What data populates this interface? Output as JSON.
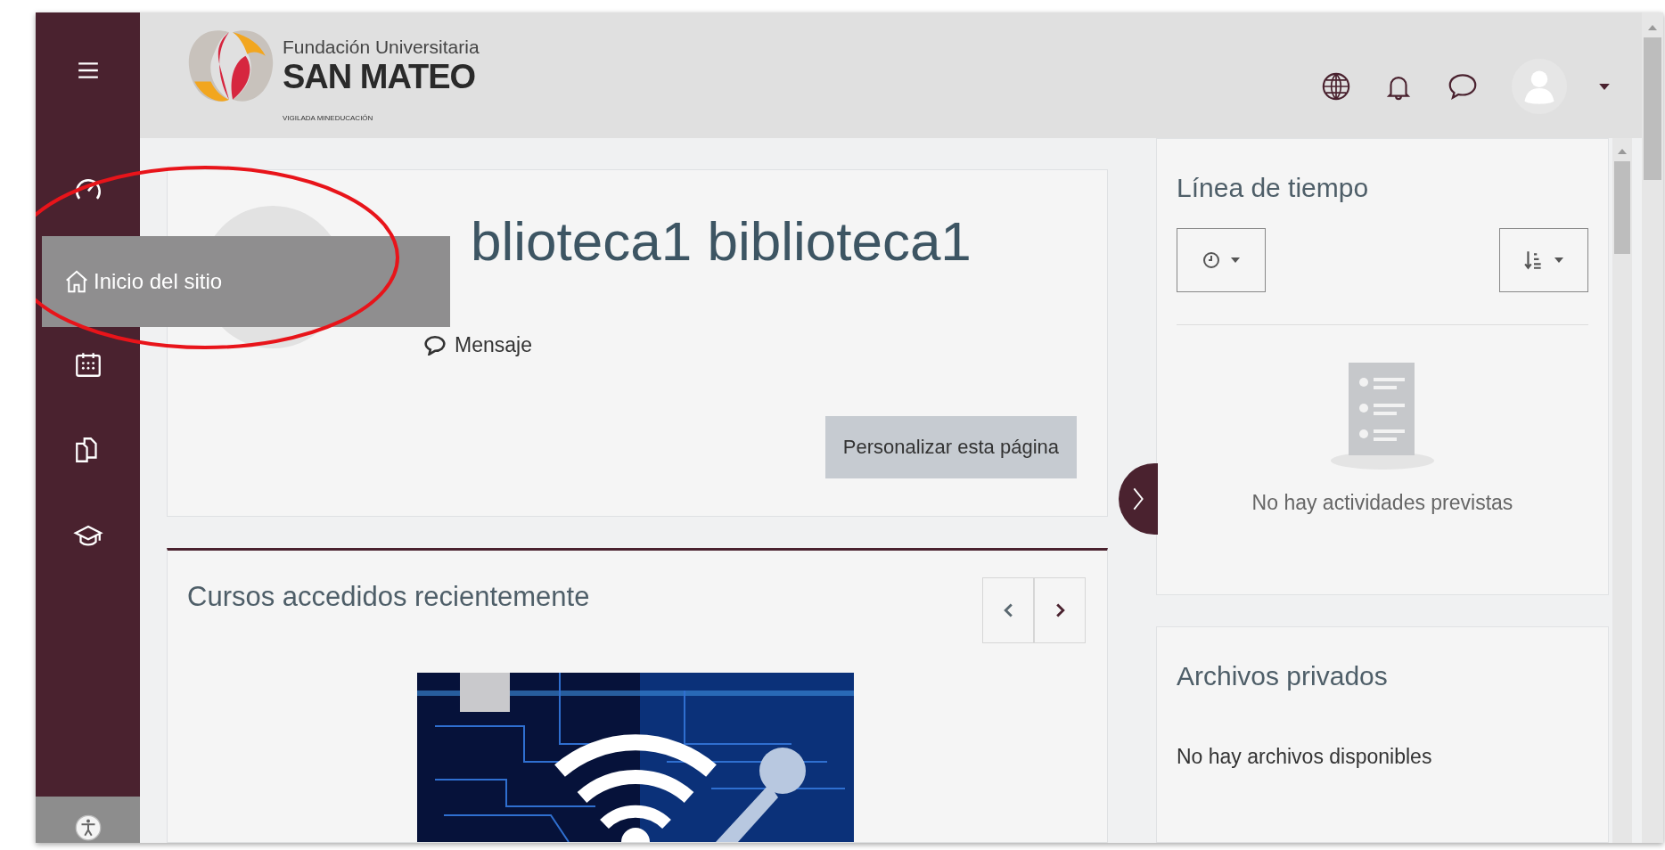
{
  "header": {
    "logo": {
      "line1": "Fundación Universitaria",
      "line2": "SAN MATEO",
      "tagline": "VIGILADA MINEDUCACIÓN"
    }
  },
  "tooltip": {
    "label": "Inicio del sitio"
  },
  "profile": {
    "name": "blioteca1 biblioteca1",
    "message_link": "Mensaje",
    "button": "Personalizar esta página"
  },
  "recent_courses": {
    "title": "Cursos accedidos recientemente"
  },
  "timeline": {
    "title": "Línea de tiempo",
    "empty": "No hay actividades previstas"
  },
  "private_files": {
    "title": "Archivos privados",
    "empty": "No hay archivos disponibles"
  }
}
